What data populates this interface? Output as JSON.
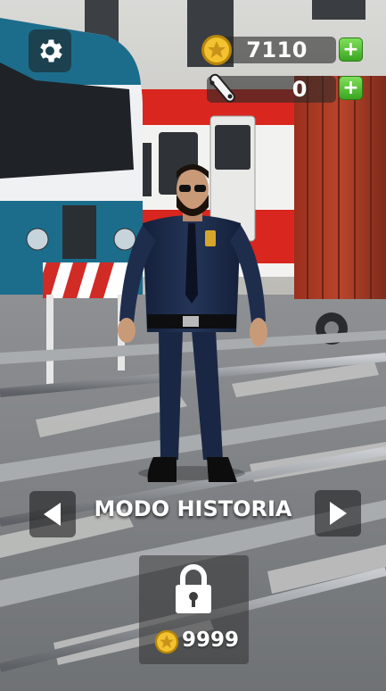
{
  "hud": {
    "coins": "7110",
    "skateboards": "0",
    "settings_icon": "gear-icon",
    "coin_icon": "coin-icon",
    "board_icon": "skateboard-icon",
    "plus_icon": "plus-icon",
    "plus_color": "#4fc232"
  },
  "mode_selector": {
    "title": "MODO HISTORIA",
    "left_icon": "arrow-left-icon",
    "right_icon": "arrow-right-icon"
  },
  "unlock": {
    "lock_icon": "lock-icon",
    "price": "9999",
    "price_icon": "coin-icon"
  },
  "scene": {
    "character": "police-officer",
    "background": "train-yard"
  }
}
